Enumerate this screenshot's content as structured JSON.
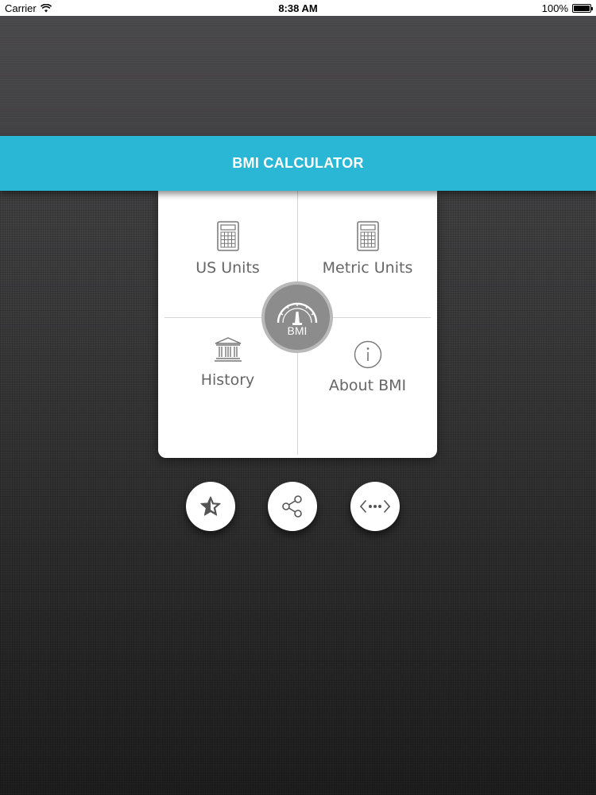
{
  "status_bar": {
    "carrier": "Carrier",
    "time": "8:38 AM",
    "battery": "100%"
  },
  "header": {
    "title": "BMI CALCULATOR"
  },
  "menu": {
    "us_units": {
      "label": "US Units",
      "icon": "calculator-icon"
    },
    "metric_units": {
      "label": "Metric Units",
      "icon": "calculator-icon"
    },
    "history": {
      "label": "History",
      "icon": "bank-building-icon"
    },
    "about": {
      "label": "About BMI",
      "icon": "info-icon"
    }
  },
  "badge": {
    "label": "BMI",
    "icon": "speedometer-icon"
  },
  "actions": [
    {
      "name": "rate",
      "icon": "star-icon"
    },
    {
      "name": "share",
      "icon": "share-icon"
    },
    {
      "name": "more",
      "icon": "more-code-icon"
    }
  ],
  "colors": {
    "accent": "#29b7d5",
    "badge": "#8c8c8c",
    "label": "#666666"
  }
}
